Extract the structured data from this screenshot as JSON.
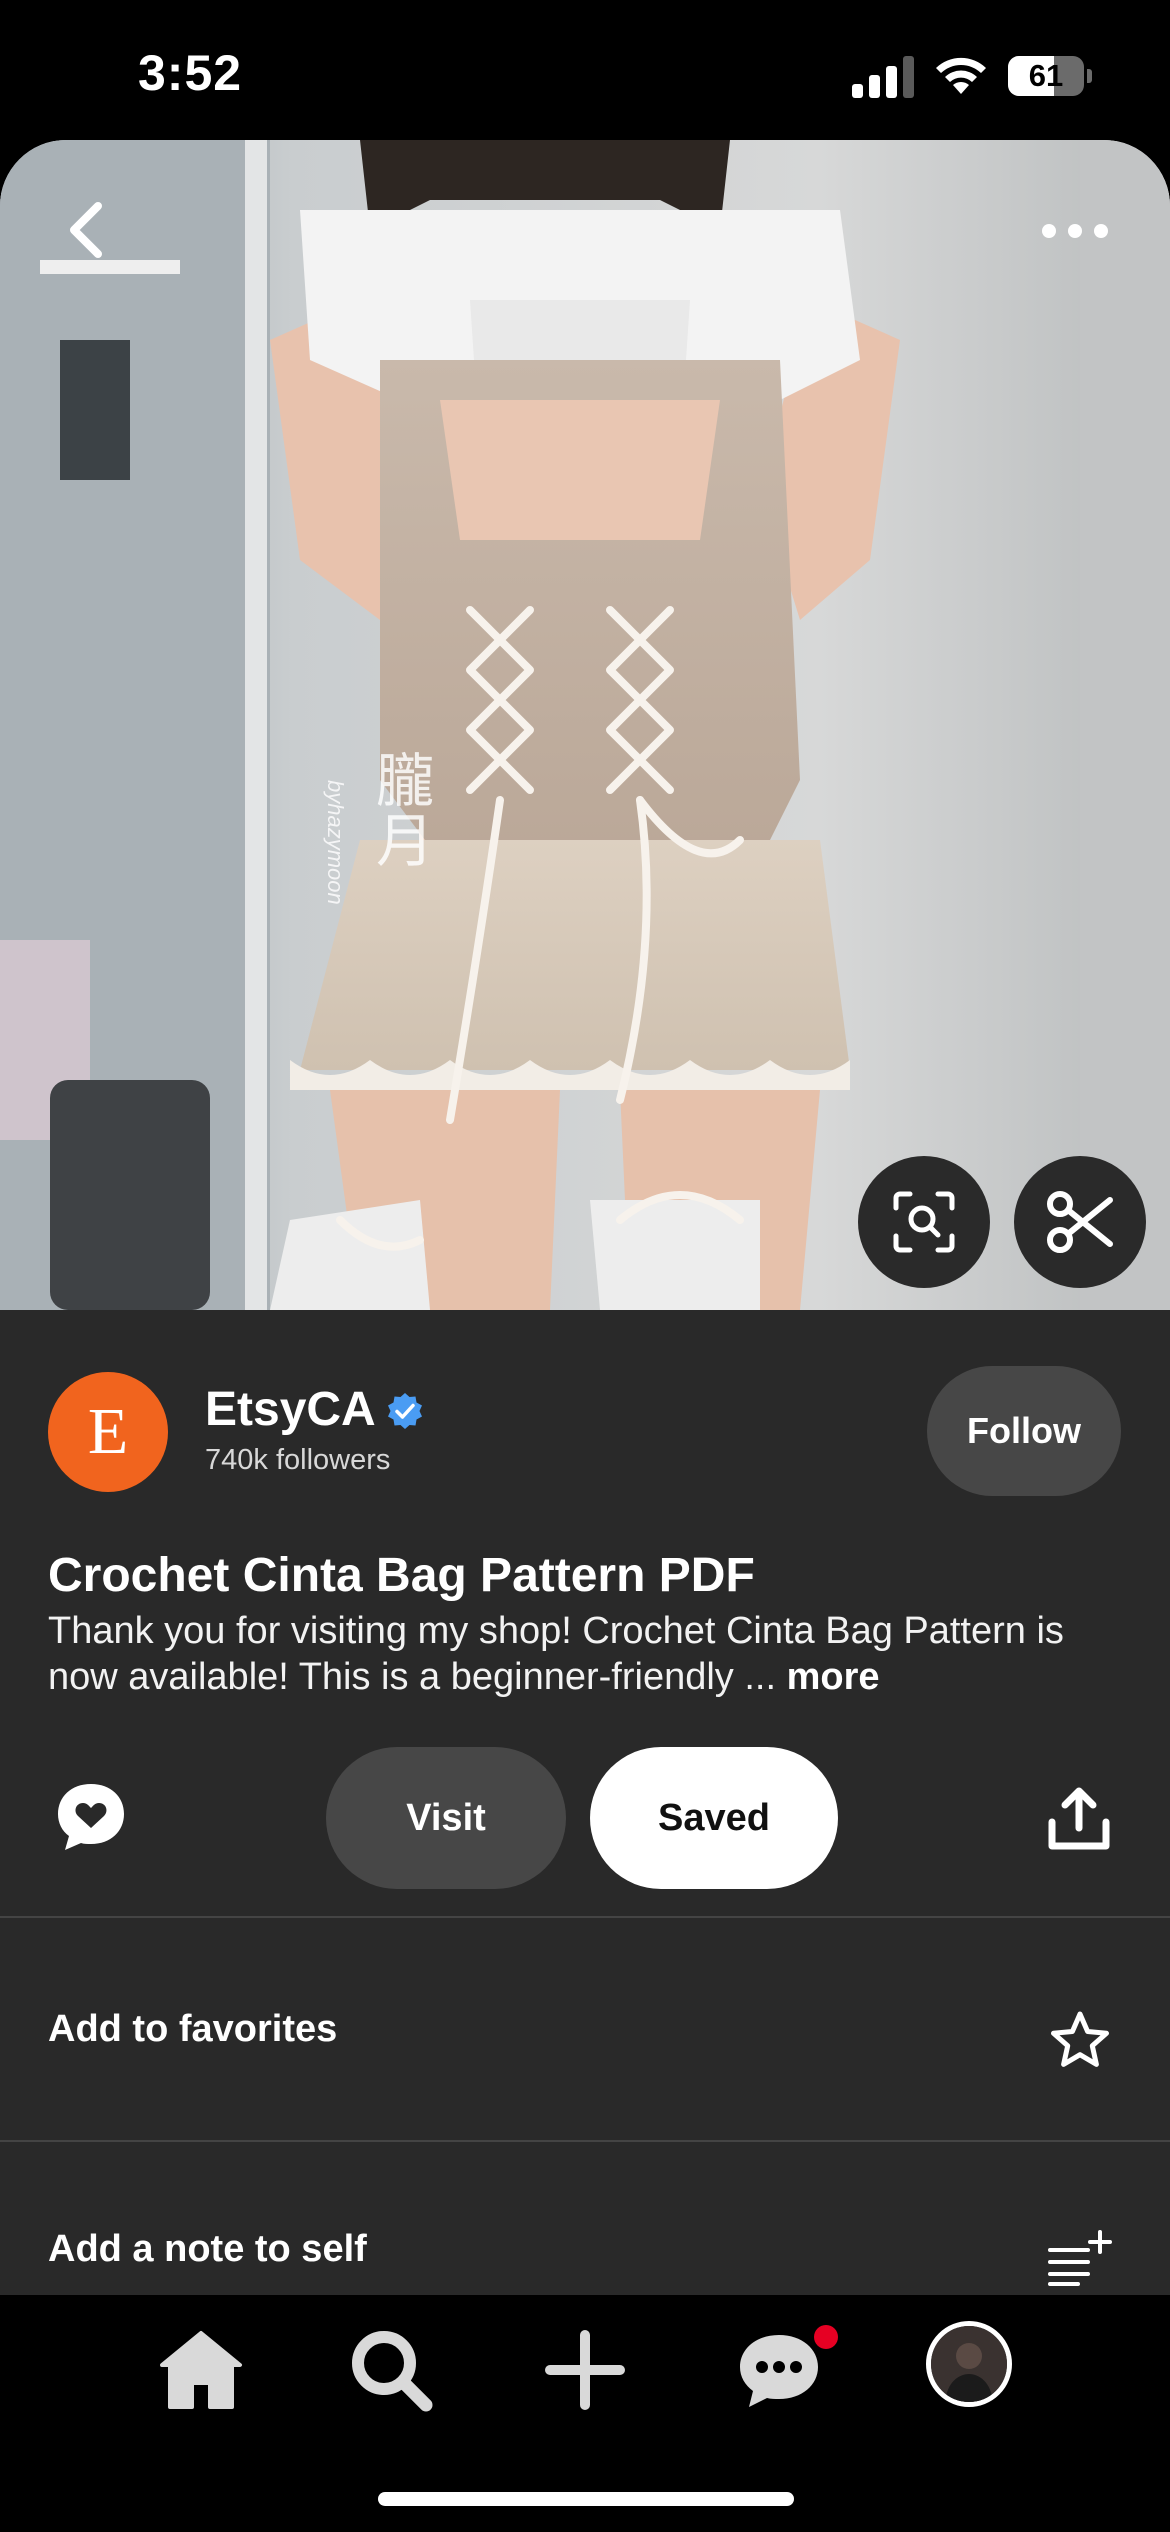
{
  "status_bar": {
    "time": "3:52",
    "battery_level": "61",
    "battery_fraction": 0.61
  },
  "hero": {
    "watermark": "朧月",
    "watermark_credit": "byhazymoon",
    "icons": {
      "back": "chevron-left-icon",
      "more": "more-horizontal-icon",
      "lens": "visual-search-icon",
      "cutout": "scissors-icon"
    }
  },
  "creator": {
    "initial": "E",
    "name": "EtsyCA",
    "verified": true,
    "followers": "740k followers",
    "follow_label": "Follow",
    "avatar_color": "#f1641e"
  },
  "pin": {
    "title": "Crochet Cinta Bag Pattern PDF",
    "description": "Thank you for visiting my shop! Crochet Cinta Bag Pattern is now available! This is a beginner-friendly ...",
    "more_label": "more"
  },
  "actions": {
    "visit_label": "Visit",
    "saved_label": "Saved",
    "comment_icon": "comment-heart-icon",
    "share_icon": "share-upload-icon"
  },
  "rows": {
    "favorites_label": "Add to favorites",
    "note_label": "Add a note to self"
  },
  "tab_bar": {
    "items": [
      "home-icon",
      "search-icon",
      "plus-icon",
      "messages-icon",
      "profile-avatar"
    ],
    "messages_has_notification": true,
    "accent": "#e60023"
  }
}
